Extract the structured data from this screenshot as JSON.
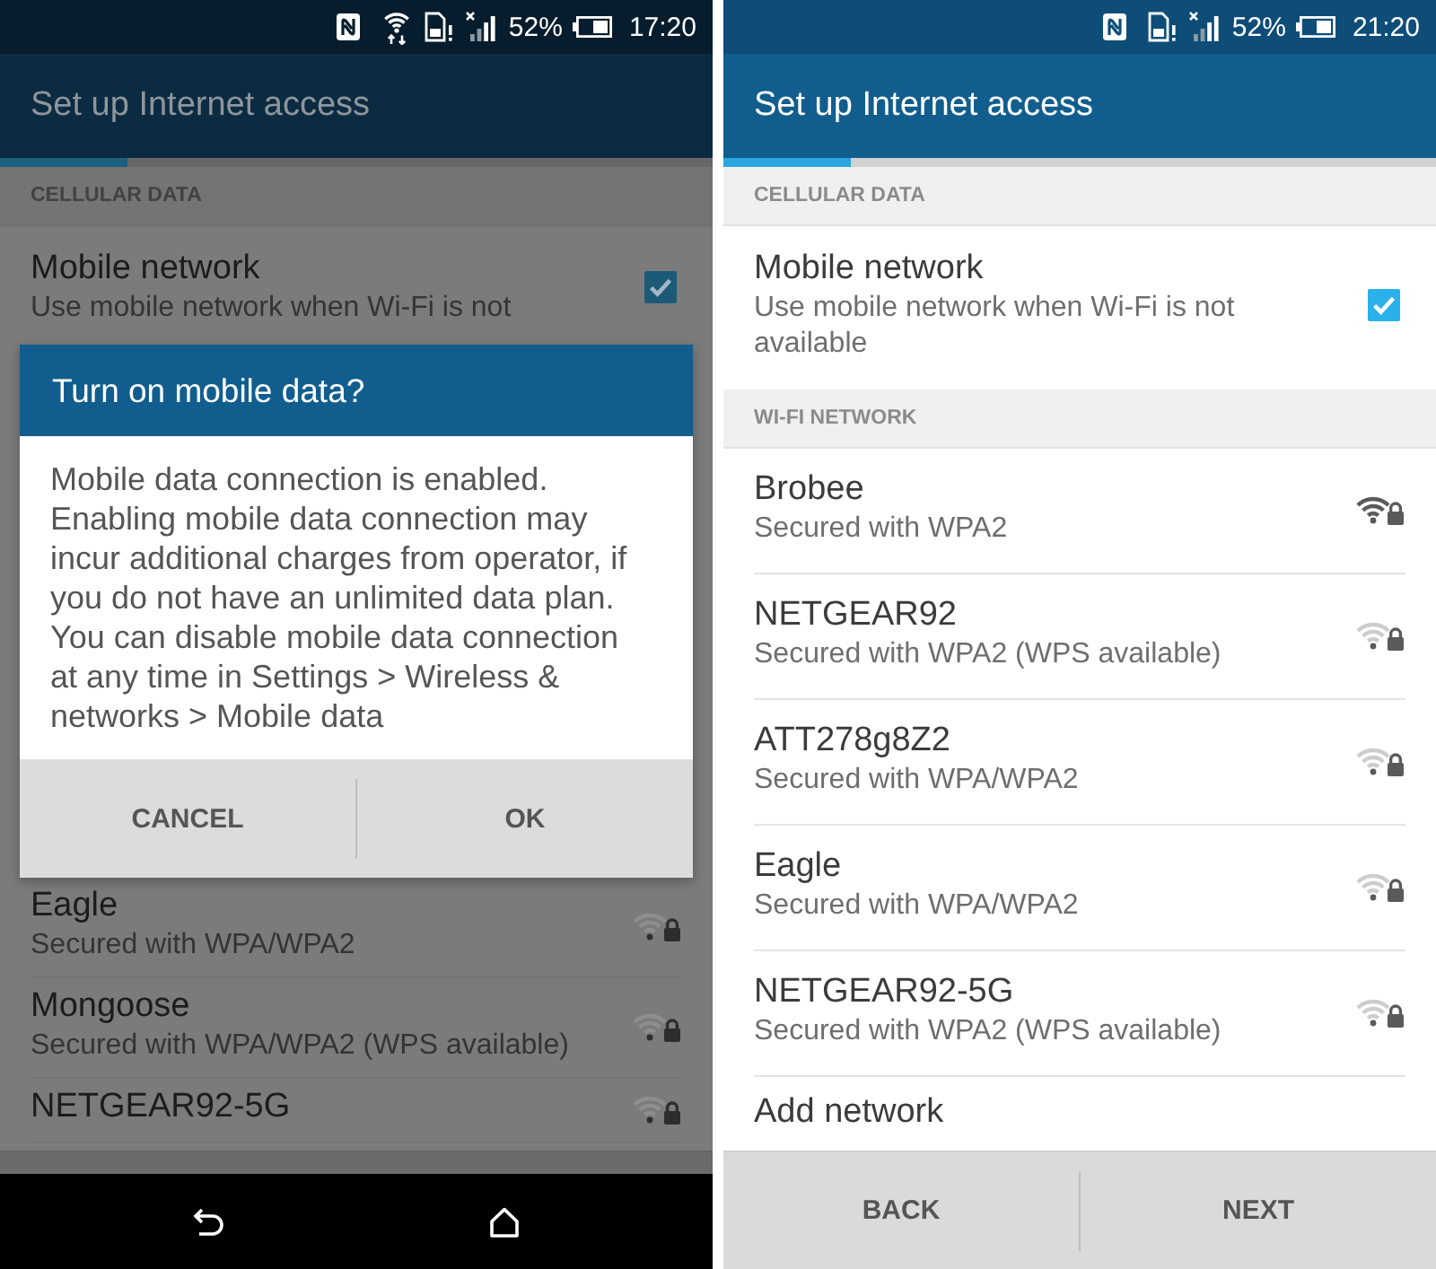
{
  "screens": [
    {
      "status_bar": {
        "wifi": true,
        "battery": "52%",
        "time": "17:20"
      },
      "app_bar": {
        "title": "Set up Internet access"
      },
      "progress": {
        "level": 0.18
      },
      "list": [
        {
          "kind": "header",
          "label": "CELLULAR DATA"
        },
        {
          "kind": "toggle",
          "title": "Mobile network",
          "description": "Use mobile network when Wi-Fi is not",
          "checked": true
        }
      ],
      "dialog": {
        "title": "Turn on mobile data?",
        "message": "Mobile data connection is enabled. Enabling mobile data connection may incur additional charges from operator, if you do not have an unlimited data plan. You can disable mobile data connection at any time in Settings > Wireless & networks > Mobile data",
        "buttons": [
          "CANCEL",
          "OK"
        ]
      },
      "list_below_dialog": [
        {
          "kind": "network",
          "title": "Eagle",
          "description": "Secured with WPA/WPA2",
          "full_signal": false,
          "locked": true
        },
        {
          "kind": "network",
          "title": "Mongoose",
          "description": "Secured with WPA/WPA2 (WPS available)",
          "full_signal": false,
          "locked": true
        },
        {
          "kind": "network",
          "title": "NETGEAR92-5G",
          "full_signal": false,
          "locked": true
        }
      ],
      "nav_bar": true
    },
    {
      "status_bar": {
        "wifi": false,
        "battery": "52%",
        "time": "21:20"
      },
      "app_bar": {
        "title": "Set up Internet access"
      },
      "progress": {
        "level": 0.18
      },
      "list": [
        {
          "kind": "header",
          "label": "CELLULAR DATA"
        },
        {
          "kind": "toggle",
          "title": "Mobile network",
          "description": "Use mobile network when Wi-Fi is not available",
          "checked": true
        },
        {
          "kind": "header",
          "label": "WI-FI NETWORK"
        },
        {
          "kind": "network",
          "title": "Brobee",
          "description": "Secured with WPA2",
          "full_signal": true,
          "locked": true
        },
        {
          "kind": "network",
          "title": "NETGEAR92",
          "description": "Secured with WPA2 (WPS available)",
          "full_signal": false,
          "locked": true
        },
        {
          "kind": "network",
          "title": "ATT278g8Z2",
          "description": "Secured with WPA/WPA2",
          "full_signal": false,
          "locked": true
        },
        {
          "kind": "network",
          "title": "Eagle",
          "description": "Secured with WPA/WPA2",
          "full_signal": false,
          "locked": true
        },
        {
          "kind": "network",
          "title": "NETGEAR92-5G",
          "description": "Secured with WPA2 (WPS available)",
          "full_signal": false,
          "locked": true
        },
        {
          "kind": "action",
          "title": "Add network"
        }
      ],
      "buttons": [
        "BACK",
        "NEXT"
      ],
      "nav_bar": false
    }
  ]
}
